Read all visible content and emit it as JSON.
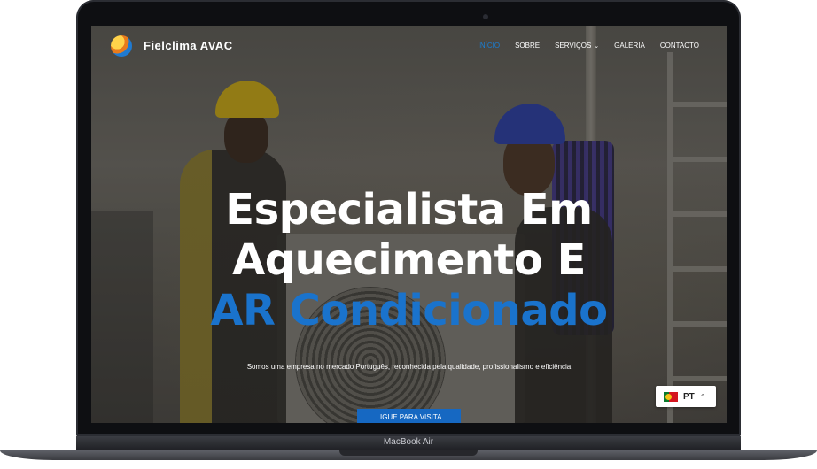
{
  "device": {
    "label": "MacBook Air"
  },
  "site": {
    "brand": "Fielclima AVAC",
    "nav": [
      {
        "label": "Início",
        "active": true
      },
      {
        "label": "Sobre",
        "active": false
      },
      {
        "label": "Serviços",
        "active": false,
        "dropdown": true
      },
      {
        "label": "Galeria",
        "active": false
      },
      {
        "label": "Contacto",
        "active": false
      }
    ],
    "hero": {
      "line1": "Especialista Em",
      "line2": "Aquecimento E",
      "line3": "AR Condicionado",
      "subtitle": "Somos uma empresa no mercado Português, reconhecida pela qualidade, profissionalismo e eficiência",
      "cta": "Ligue para visita"
    },
    "language": {
      "code": "PT",
      "flag": "portugal-flag-icon"
    }
  },
  "colors": {
    "accent": "#1a73cc",
    "cta": "#1668c2",
    "nav_active": "#1a7fd4"
  }
}
